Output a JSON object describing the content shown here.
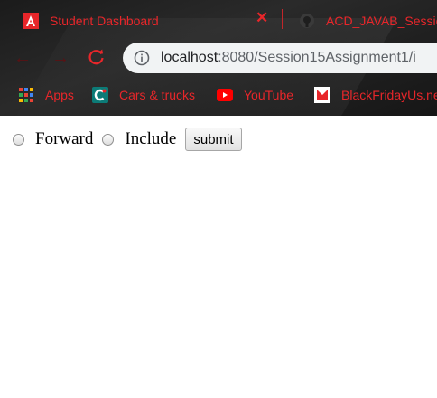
{
  "tabs": [
    {
      "title": "Student Dashboard",
      "active": true,
      "icon": "angular-logo-icon"
    },
    {
      "title": "ACD_JAVAB_Session",
      "active": false,
      "icon": "github-icon"
    }
  ],
  "address_bar": {
    "host": "localhost",
    "path": ":8080/Session15Assignment1/i"
  },
  "bookmarks": [
    {
      "label": "Apps",
      "icon": "apps-grid-icon"
    },
    {
      "label": "Cars & trucks",
      "icon": "cars-trucks-icon"
    },
    {
      "label": "YouTube",
      "icon": "youtube-icon"
    },
    {
      "label": "BlackFridayUs.ne",
      "icon": "blackfriday-icon"
    }
  ],
  "form": {
    "option1": "Forward",
    "option2": "Include",
    "submit_label": "submit"
  },
  "colors": {
    "accent": "#e8262a",
    "chrome_bg": "#1e1e1e",
    "omnibox_bg": "#f1f3f4"
  }
}
